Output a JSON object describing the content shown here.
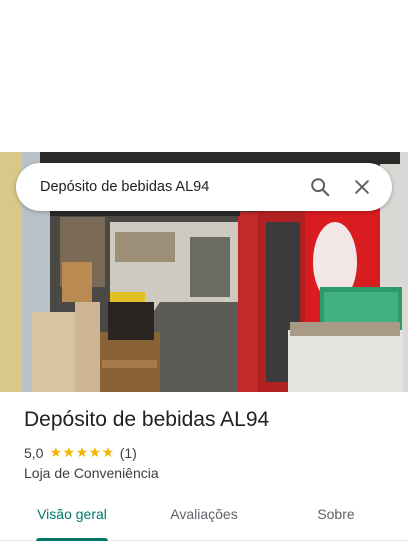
{
  "search": {
    "query": "Depósito de bebidas AL94",
    "search_icon": "search-icon",
    "close_icon": "close-icon"
  },
  "photo": {
    "description_icon": "store-photo"
  },
  "place": {
    "title": "Depósito de bebidas AL94",
    "rating": "5,0",
    "stars": "★★★★★",
    "review_count": "(1)",
    "category": "Loja de Conveniência"
  },
  "tabs": [
    {
      "label": "Visão geral",
      "active": true
    },
    {
      "label": "Avaliações",
      "active": false
    },
    {
      "label": "Sobre",
      "active": false
    }
  ],
  "colors": {
    "accent": "#00796b",
    "star": "#f5b400"
  }
}
